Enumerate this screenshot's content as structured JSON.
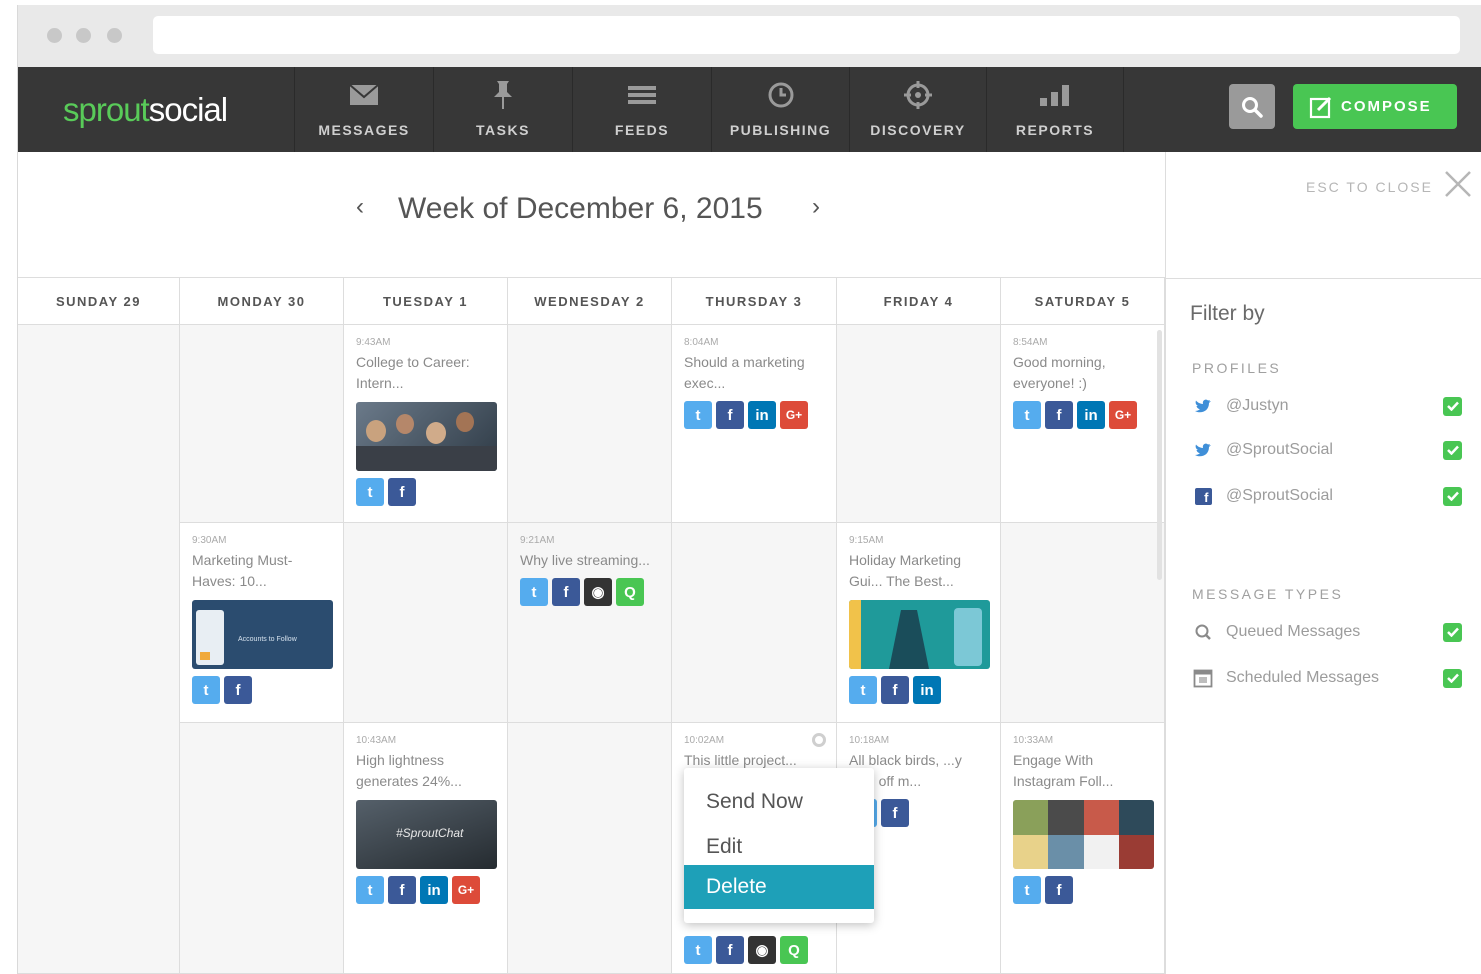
{
  "app": {
    "logo_part1": "sprout",
    "logo_part2": "social",
    "nav": [
      {
        "label": "MESSAGES",
        "icon": "envelope-icon"
      },
      {
        "label": "TASKS",
        "icon": "pin-icon"
      },
      {
        "label": "FEEDS",
        "icon": "list-icon"
      },
      {
        "label": "PUBLISHING",
        "icon": "clock-icon"
      },
      {
        "label": "DISCOVERY",
        "icon": "crosshair-icon"
      },
      {
        "label": "REPORTS",
        "icon": "bar-chart-icon"
      }
    ],
    "compose_label": "COMPOSE"
  },
  "calendar": {
    "title": "Week of December 6, 2015",
    "prev": "‹",
    "next": "›",
    "days": [
      "SUNDAY 29",
      "MONDAY 30",
      "TUESDAY 1",
      "WEDNESDAY 2",
      "THURSDAY 3",
      "FRIDAY 4",
      "SATURDAY 5"
    ],
    "posts": {
      "tue1": {
        "time": "9:43AM",
        "text": "College to Career: Intern..."
      },
      "thu1": {
        "time": "8:04AM",
        "text": "Should a marketing exec..."
      },
      "sat1": {
        "time": "8:54AM",
        "text": "Good morning, everyone! :)"
      },
      "mon2": {
        "time": "9:30AM",
        "text": "Marketing Must-Haves: 10..."
      },
      "wed2": {
        "time": "9:21AM",
        "text": "Why live streaming..."
      },
      "fri2": {
        "time": "9:15AM",
        "text": "Holiday Marketing Gui... The Best..."
      },
      "tue3": {
        "time": "10:43AM",
        "text": "High lightness generates 24%..."
      },
      "thu3": {
        "time": "10:02AM",
        "text": "This little project..."
      },
      "fri3": {
        "time": "10:18AM",
        "text": "All black birds, ...y sing off m..."
      },
      "sat3": {
        "time": "10:33AM",
        "text": "Engage With Instagram Foll..."
      }
    },
    "mon2_img_text": "Accounts to Follow",
    "tue3_img_text": "#SproutChat"
  },
  "context_menu": {
    "send_now": "Send Now",
    "edit": "Edit",
    "delete": "Delete"
  },
  "filter": {
    "esc_label": "ESC TO CLOSE",
    "title": "Filter by",
    "profiles_heading": "PROFILES",
    "profiles": [
      "@Justyn",
      "@SproutSocial",
      "@SproutSocial"
    ],
    "types_heading": "MESSAGE TYPES",
    "types": [
      "Queued Messages",
      "Scheduled Messages"
    ]
  },
  "colors": {
    "brand_green": "#59cb59",
    "compose_green": "#49c653",
    "navbar": "#373737",
    "menu_active": "#1ea0b8",
    "twitter": "#55acee",
    "facebook": "#3b5998",
    "linkedin": "#0077b5",
    "googleplus": "#dd4b39"
  }
}
